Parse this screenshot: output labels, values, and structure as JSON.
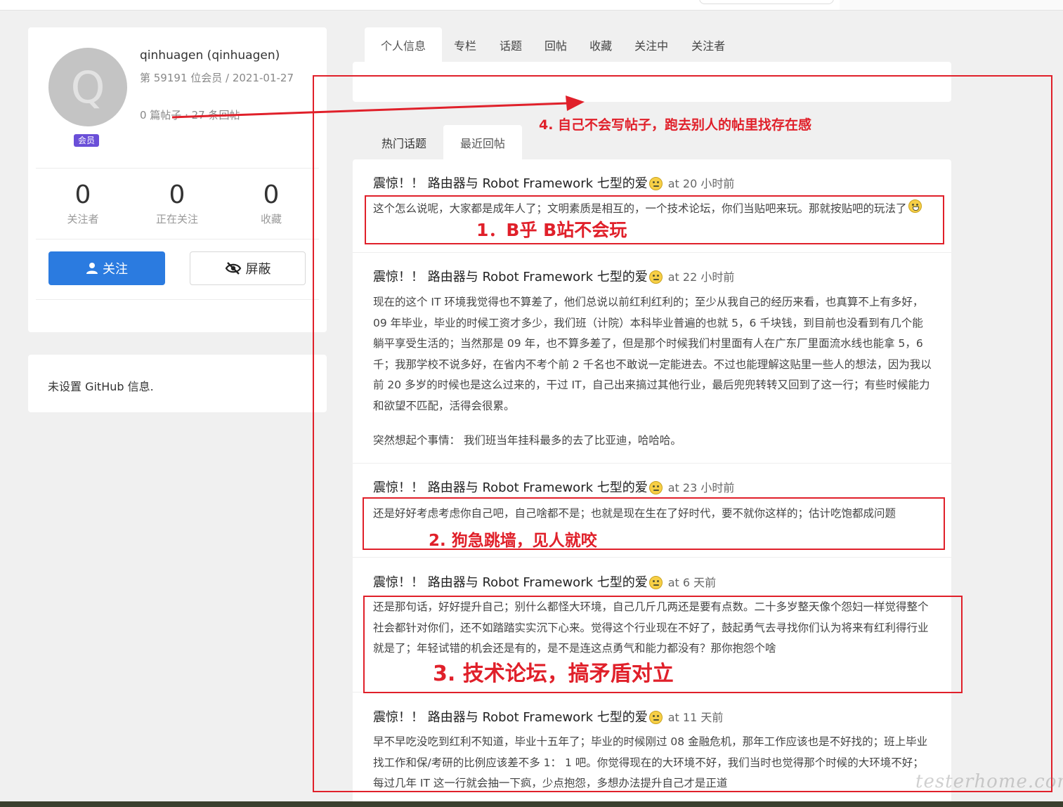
{
  "profile": {
    "avatar_letter": "Q",
    "member_badge": "会员",
    "username": "qinhuagen (qinhuagen)",
    "member_info": "第 59191 位会员 / 2021-01-27",
    "post_count": "0 篇帖子 · 27 条回帖",
    "stats": [
      {
        "value": "0",
        "label": "关注者"
      },
      {
        "value": "0",
        "label": "正在关注"
      },
      {
        "value": "0",
        "label": "收藏"
      }
    ],
    "follow_label": "关注",
    "block_label": "屏蔽"
  },
  "github": {
    "text": "未设置 GitHub 信息."
  },
  "tabs": [
    "个人信息",
    "专栏",
    "话题",
    "回帖",
    "收藏",
    "关注中",
    "关注者"
  ],
  "subtabs": [
    "热门话题",
    "最近回帖"
  ],
  "replies": [
    {
      "topic": "震惊！！ 路由器与 Robot Framework 七型的爱",
      "time": "at 20 小时前",
      "paragraphs": [
        "这个怎么说呢，大家都是成年人了；文明素质是相互的，一个技术论坛，你们当贴吧来玩。那就按贴吧的玩法了"
      ]
    },
    {
      "topic": "震惊！！ 路由器与 Robot Framework 七型的爱",
      "time": "at 22 小时前",
      "paragraphs": [
        "现在的这个 IT 环境我觉得也不算差了，他们总说以前红利红利的；至少从我自己的经历来看，也真算不上有多好，09 年毕业，毕业的时候工资才多少，我们班（计院）本科毕业普遍的也就 5，6 千块钱，到目前也没看到有几个能躺平享受生活的；当然那是 09 年，也不算多差了，但是那个时候我们村里面有人在广东厂里面流水线也能拿 5，6 千；我那学校不说多好，在省内不考个前 2 千名也不敢说一定能进去。不过也能理解这贴里一些人的想法，因为我以前 20 多岁的时候也是这么过来的，干过 IT，自己出来搞过其他行业，最后兜兜转转又回到了这一行；有些时候能力和欲望不匹配，活得会很累。",
        "突然想起个事情： 我们班当年挂科最多的去了比亚迪，哈哈哈。"
      ]
    },
    {
      "topic": "震惊！！ 路由器与 Robot Framework 七型的爱",
      "time": "at 23 小时前",
      "paragraphs": [
        "还是好好考虑考虑你自己吧，自己啥都不是；也就是现在生在了好时代，要不就你这样的；估计吃饱都成问题"
      ]
    },
    {
      "topic": "震惊！！ 路由器与 Robot Framework 七型的爱",
      "time": "at 6 天前",
      "paragraphs": [
        "还是那句话，好好提升自己；别什么都怪大环境，自己几斤几两还是要有点数。二十多岁整天像个怨妇一样觉得整个社会都针对你们，还不如踏踏实实沉下心来。觉得这个行业现在不好了，鼓起勇气去寻找你们认为将来有红利得行业就是了；年轻试错的机会还是有的，是不是连这点勇气和能力都没有？那你抱怨个啥"
      ]
    },
    {
      "topic": "震惊！！ 路由器与 Robot Framework 七型的爱",
      "time": "at 11 天前",
      "paragraphs": [
        "早不早吃没吃到红利不知道，毕业十五年了；毕业的时候刚过 08 金融危机，那年工作应该也是不好找的；班上毕业找工作和保/考研的比例应该差不多 1： 1 吧。你觉得现在的大环境不好，我们当时也觉得那个时候的大环境不好；每过几年 IT 这一行就会抽一下疯，少点抱怨，多想办法提升自己才是正道"
      ]
    }
  ],
  "annotations": {
    "a1": "1．B乎 B站不会玩",
    "a2": "2. 狗急跳墙，见人就咬",
    "a3": "3. 技术论坛，搞矛盾对立",
    "a4": "4.   自己不会写帖子，跑去别人的帖里找存在感"
  },
  "watermark": "testerhome.com",
  "colors": {
    "accent": "#2b7be0",
    "annotation": "#e0202a",
    "badge": "#6a4fd8"
  }
}
